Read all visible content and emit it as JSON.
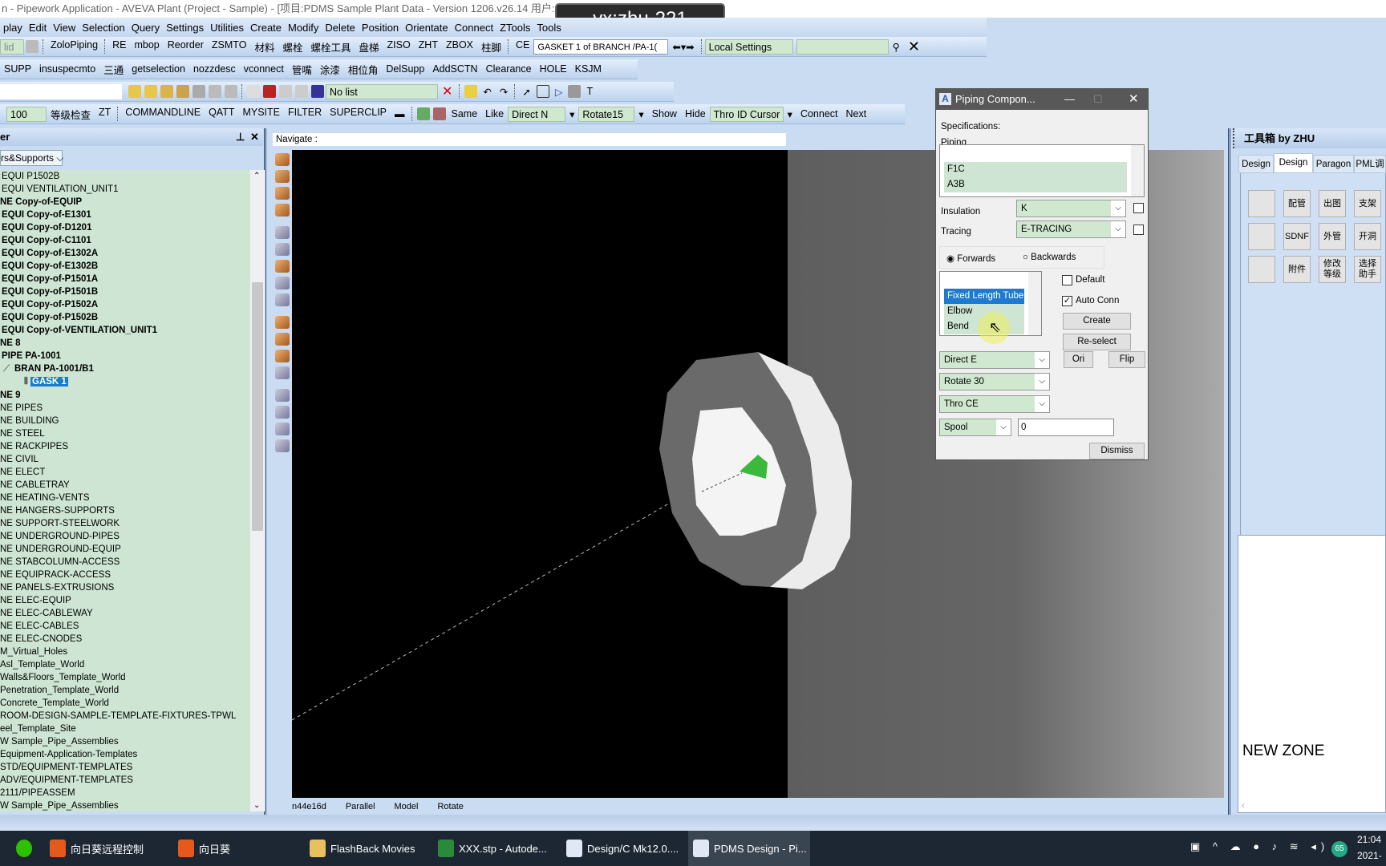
{
  "window": {
    "title": "n - Pipework Application - AVEVA Plant (Project - Sample) - [项目:PDMS Sample Plant Data - Version 1206.v26.14 用户:S",
    "watermark": "vx:zhu-221"
  },
  "menu": [
    "play",
    "Edit",
    "View",
    "Selection",
    "Query",
    "Settings",
    "Utilities",
    "Create",
    "Modify",
    "Delete",
    "Position",
    "Orientate",
    "Connect",
    "ZTools",
    "Tools"
  ],
  "toolbar1": {
    "items": [
      "ZoloPiping",
      "RE",
      "mbop",
      "Reorder",
      "ZSMTO",
      "材料",
      "螺栓",
      "螺栓工具",
      "盘梯",
      "ZISO",
      "ZHT",
      "ZBOX",
      "柱脚",
      "CE"
    ],
    "ce_value": "GASKET 1 of BRANCH /PA-1(",
    "local_settings": "Local Settings",
    "left_combo": "lid"
  },
  "toolbar2": {
    "items": [
      "SUPP",
      "insuspecmto",
      "三通",
      "getselection",
      "nozzdesc",
      "vconnect",
      "管嘴",
      "涂漆",
      "相位角",
      "DelSupp",
      "AddSCTN",
      "Clearance",
      "HOLE",
      "KSJM"
    ]
  },
  "toolbar3": {
    "list_value": "No list"
  },
  "toolbar4": {
    "value": "100",
    "items": [
      "等级检查",
      "ZT",
      "COMMANDLINE",
      "QATT",
      "MYSITE",
      "FILTER",
      "SUPERCLIP"
    ],
    "items2": [
      "Same",
      "Like"
    ],
    "direct": "Direct N",
    "rotate": "Rotate15",
    "items3": [
      "Show",
      "Hide"
    ],
    "thro": "Thro ID Cursor",
    "items4": [
      "Connect",
      "Next"
    ]
  },
  "explorer": {
    "title": "er",
    "filter": "rs&Supports",
    "rows": [
      {
        "t": "EQUI P1502B",
        "i": 1,
        "b": false
      },
      {
        "t": "EQUI VENTILATION_UNIT1",
        "i": 1,
        "b": false
      },
      {
        "t": "NE Copy-of-EQUIP",
        "i": 0,
        "b": true
      },
      {
        "t": "EQUI Copy-of-E1301",
        "i": 1,
        "b": true
      },
      {
        "t": "EQUI Copy-of-D1201",
        "i": 1,
        "b": true
      },
      {
        "t": "EQUI Copy-of-C1101",
        "i": 1,
        "b": true
      },
      {
        "t": "EQUI Copy-of-E1302A",
        "i": 1,
        "b": true
      },
      {
        "t": "EQUI Copy-of-E1302B",
        "i": 1,
        "b": true
      },
      {
        "t": "EQUI Copy-of-P1501A",
        "i": 1,
        "b": true
      },
      {
        "t": "EQUI Copy-of-P1501B",
        "i": 1,
        "b": true
      },
      {
        "t": "EQUI Copy-of-P1502A",
        "i": 1,
        "b": true
      },
      {
        "t": "EQUI Copy-of-P1502B",
        "i": 1,
        "b": true
      },
      {
        "t": "EQUI Copy-of-VENTILATION_UNIT1",
        "i": 1,
        "b": true
      },
      {
        "t": "NE 8",
        "i": 0,
        "b": true
      },
      {
        "t": "PIPE PA-1001",
        "i": 1,
        "b": true
      },
      {
        "t": "BRAN PA-1001/B1",
        "i": 2,
        "b": true
      },
      {
        "t": "GASK 1",
        "i": 3,
        "b": true,
        "sel": true
      },
      {
        "t": "NE 9",
        "i": 0,
        "b": true
      },
      {
        "t": "NE PIPES",
        "i": 0,
        "b": false
      },
      {
        "t": "NE BUILDING",
        "i": 0,
        "b": false
      },
      {
        "t": "NE STEEL",
        "i": 0,
        "b": false
      },
      {
        "t": "NE RACKPIPES",
        "i": 0,
        "b": false
      },
      {
        "t": "NE CIVIL",
        "i": 0,
        "b": false
      },
      {
        "t": "NE ELECT",
        "i": 0,
        "b": false
      },
      {
        "t": "NE CABLETRAY",
        "i": 0,
        "b": false
      },
      {
        "t": "NE HEATING-VENTS",
        "i": 0,
        "b": false
      },
      {
        "t": "NE HANGERS-SUPPORTS",
        "i": 0,
        "b": false
      },
      {
        "t": "NE SUPPORT-STEELWORK",
        "i": 0,
        "b": false
      },
      {
        "t": "NE UNDERGROUND-PIPES",
        "i": 0,
        "b": false
      },
      {
        "t": "NE UNDERGROUND-EQUIP",
        "i": 0,
        "b": false
      },
      {
        "t": "NE STABCOLUMN-ACCESS",
        "i": 0,
        "b": false
      },
      {
        "t": "NE EQUIPRACK-ACCESS",
        "i": 0,
        "b": false
      },
      {
        "t": "NE PANELS-EXTRUSIONS",
        "i": 0,
        "b": false
      },
      {
        "t": "NE ELEC-EQUIP",
        "i": 0,
        "b": false
      },
      {
        "t": "NE ELEC-CABLEWAY",
        "i": 0,
        "b": false
      },
      {
        "t": "NE ELEC-CABLES",
        "i": 0,
        "b": false
      },
      {
        "t": "NE ELEC-CNODES",
        "i": 0,
        "b": false
      },
      {
        "t": "M_Virtual_Holes",
        "i": 0,
        "b": false
      },
      {
        "t": "Asl_Template_World",
        "i": 0,
        "b": false
      },
      {
        "t": "Walls&Floors_Template_World",
        "i": 0,
        "b": false
      },
      {
        "t": "Penetration_Template_World",
        "i": 0,
        "b": false
      },
      {
        "t": "Concrete_Template_World",
        "i": 0,
        "b": false
      },
      {
        "t": "ROOM-DESIGN-SAMPLE-TEMPLATE-FIXTURES-TPWL",
        "i": 0,
        "b": false
      },
      {
        "t": "eel_Template_Site",
        "i": 0,
        "b": false
      },
      {
        "t": "W Sample_Pipe_Assemblies",
        "i": 0,
        "b": false
      },
      {
        "t": "Equipment-Application-Templates",
        "i": 0,
        "b": false
      },
      {
        "t": "STD/EQUIPMENT-TEMPLATES",
        "i": 0,
        "b": false
      },
      {
        "t": "ADV/EQUIPMENT-TEMPLATES",
        "i": 0,
        "b": false
      },
      {
        "t": "2111/PIPEASSEM",
        "i": 0,
        "b": false
      },
      {
        "t": "W Sample_Pipe_Assemblies",
        "i": 0,
        "b": false
      }
    ]
  },
  "viewer": {
    "navigate": "Navigate :",
    "status": [
      "n44e16d",
      "Parallel",
      "Model",
      "Rotate"
    ]
  },
  "dialog": {
    "title": "Piping Compon...",
    "specifications": "Specifications:",
    "piping": "Piping",
    "spec_list": [
      "",
      "F1C",
      "A3B"
    ],
    "insulation_label": "Insulation",
    "insulation": "K",
    "tracing_label": "Tracing",
    "tracing": "E-TRACING",
    "forwards": "Forwards",
    "backwards": "Backwards",
    "direction": "Forwards",
    "components": [
      "",
      "Fixed Length Tube",
      "Elbow",
      "Bend"
    ],
    "selected_component": "Fixed Length Tube",
    "default": "Default",
    "default_checked": false,
    "auto_conn": "Auto Conn",
    "auto_conn_checked": true,
    "create": "Create",
    "reselect": "Re-select",
    "direct": "Direct E",
    "ori": "Ori",
    "flip": "Flip",
    "rotate": "Rotate 30",
    "thro": "Thro CE",
    "spool": "Spool",
    "spool_value": "0",
    "dismiss": "Dismiss"
  },
  "toolbox": {
    "title": "工具箱 by ZHU",
    "tabs": [
      "Design",
      "Design",
      "Paragon",
      "PML调"
    ],
    "active_tab": 1,
    "buttons": [
      [
        "",
        "配管",
        "出图",
        "支架"
      ],
      [
        "",
        "SDNF",
        "外管",
        "开洞"
      ],
      [
        "",
        "附件",
        "修改\n等级",
        "选择\n助手"
      ]
    ],
    "zone": "NEW ZONE"
  },
  "taskbar": {
    "items": [
      "向日葵远程控制",
      "向日葵",
      "FlashBack Movies",
      "XXX.stp - Autode...",
      "Design/C Mk12.0....",
      "PDMS Design - Pi..."
    ],
    "active": 5,
    "time": "21:04",
    "date": "2021-"
  },
  "colors": {
    "selection": "#1c7bd0",
    "tree_bg": "#cde5d2",
    "accent_combo": "#cfe8cf",
    "cone": "#3cb83c"
  }
}
